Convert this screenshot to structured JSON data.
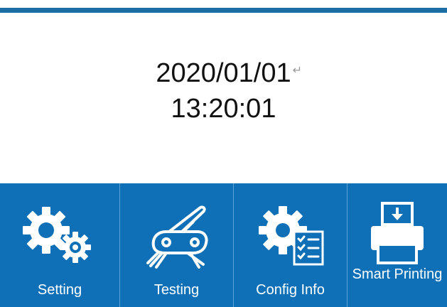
{
  "clock": {
    "date": "2020/01/01",
    "time": "13:20:01"
  },
  "menu": {
    "items": [
      {
        "label": "Setting",
        "icon": "gears-icon"
      },
      {
        "label": "Testing",
        "icon": "multitool-icon"
      },
      {
        "label": "Config Info",
        "icon": "config-gear-list-icon"
      },
      {
        "label": "Smart Printing",
        "icon": "printer-icon"
      }
    ]
  },
  "colors": {
    "brand_blue": "#0f70b7",
    "top_bar_blue": "#1c6ea4",
    "text": "#111111",
    "label_text": "#ffffff"
  }
}
